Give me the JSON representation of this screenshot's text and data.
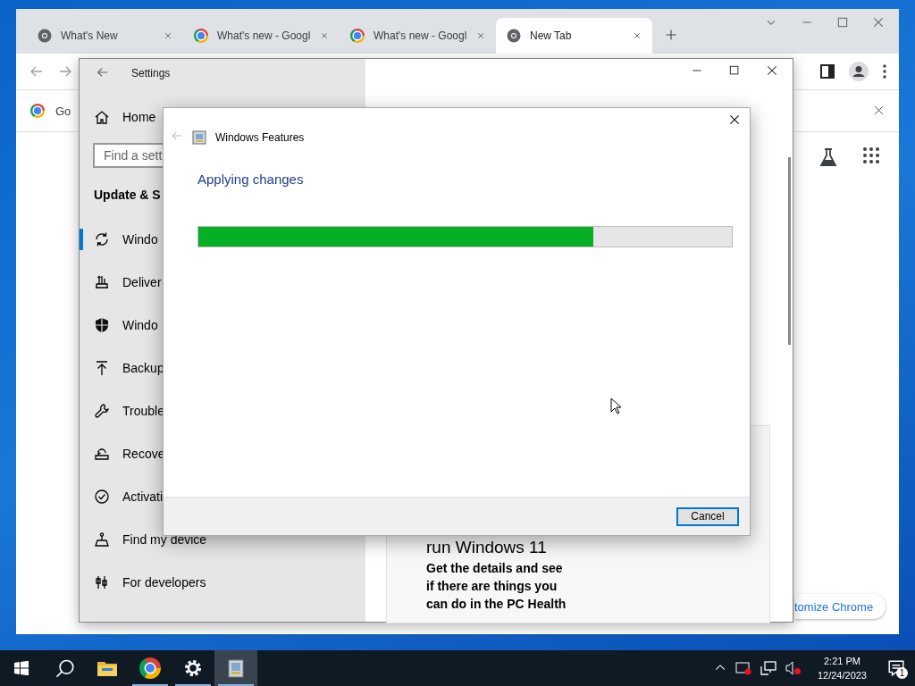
{
  "browser": {
    "tabs": [
      {
        "label": "What's New",
        "selected": false
      },
      {
        "label": "What's new - Googl",
        "selected": false
      },
      {
        "label": "What's new - Googl",
        "selected": false
      },
      {
        "label": "New Tab",
        "selected": true
      }
    ],
    "bookmark": "Go",
    "customize_button": "tomize Chrome"
  },
  "settings": {
    "title": "Settings",
    "home": "Home",
    "search": {
      "placeholder": "Find a sett"
    },
    "section": "Update & S",
    "nav": [
      {
        "label": "Windo",
        "selected": true
      },
      {
        "label": "Deliver",
        "selected": false
      },
      {
        "label": "Windo",
        "selected": false
      },
      {
        "label": "Backup",
        "selected": false
      },
      {
        "label": "Trouble",
        "selected": false
      },
      {
        "label": "Recove",
        "selected": false
      },
      {
        "label": "Activati",
        "selected": false
      },
      {
        "label": "Find my device",
        "selected": false
      },
      {
        "label": "For developers",
        "selected": false
      }
    ],
    "card": {
      "heading": "run Windows 11",
      "body": "Get the details and see if there are things you can do in the PC Health"
    }
  },
  "dialog": {
    "title": "Windows Features",
    "status": "Applying changes",
    "progress": {
      "level": 0.74
    },
    "buttons": [
      "Cancel"
    ]
  },
  "taskbar": {
    "apps": [
      {
        "kind": "explorer",
        "active": false,
        "running": false
      },
      {
        "kind": "chrome",
        "active": false,
        "running": true
      },
      {
        "kind": "settings",
        "active": false,
        "running": true
      },
      {
        "kind": "features",
        "active": true,
        "running": true
      }
    ],
    "time": "2:21 PM",
    "date": "12/24/2023",
    "notifications": "1"
  }
}
